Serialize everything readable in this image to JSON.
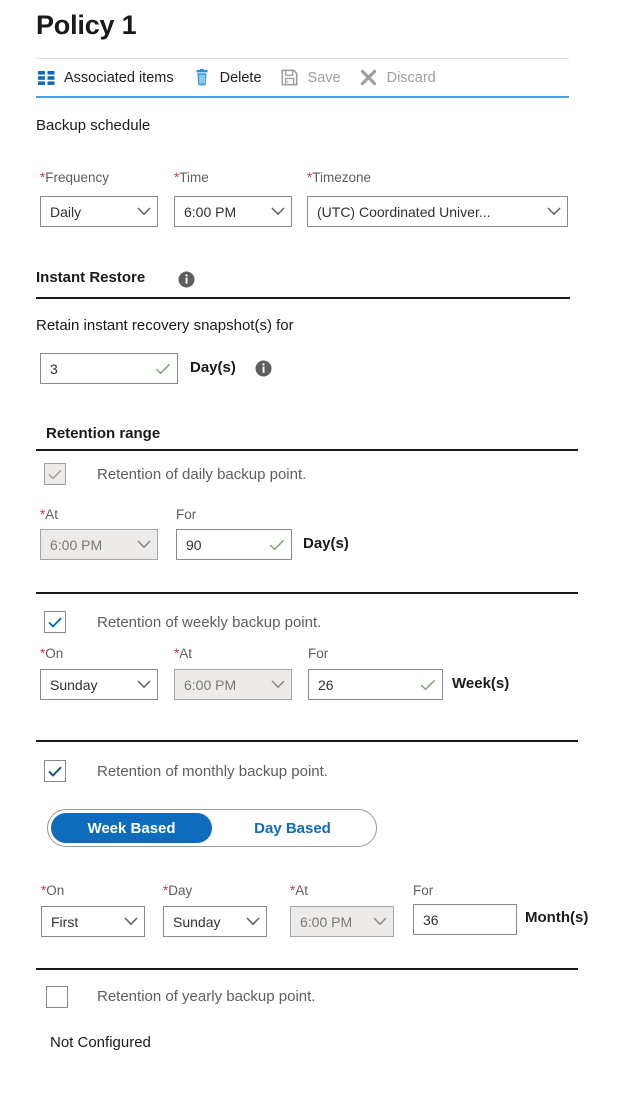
{
  "page": {
    "title": "Policy 1"
  },
  "toolbar": {
    "items": [
      {
        "label": "Associated items",
        "icon": "grid-icon",
        "enabled": true
      },
      {
        "label": "Delete",
        "icon": "trash-icon",
        "enabled": true
      },
      {
        "label": "Save",
        "icon": "save-icon",
        "enabled": false
      },
      {
        "label": "Discard",
        "icon": "discard-x-icon",
        "enabled": false
      }
    ]
  },
  "backup_schedule": {
    "heading": "Backup schedule",
    "frequency": {
      "label": "Frequency",
      "required": "*",
      "value": "Daily"
    },
    "time": {
      "label": "Time",
      "required": "*",
      "value": "6:00 PM"
    },
    "timezone": {
      "label": "Timezone",
      "required": "*",
      "value": "(UTC) Coordinated Univer..."
    }
  },
  "instant_restore": {
    "heading": "Instant Restore",
    "info_icon": "info-icon",
    "description": "Retain instant recovery snapshot(s) for",
    "days_value": "3",
    "days_unit": "Day(s)",
    "unit_info_icon": "info-icon"
  },
  "retention_range": {
    "heading": "Retention range",
    "daily": {
      "checked": true,
      "enabled": false,
      "label": "Retention of daily backup point.",
      "at": {
        "label": "At",
        "required": "*",
        "value": "6:00 PM",
        "enabled": false
      },
      "for": {
        "label": "For",
        "required": "",
        "value": "90",
        "enabled": true
      },
      "unit": "Day(s)"
    },
    "weekly": {
      "checked": true,
      "enabled": true,
      "label": "Retention of weekly backup point.",
      "on": {
        "label": "On",
        "required": "*",
        "value": "Sunday",
        "enabled": true
      },
      "at": {
        "label": "At",
        "required": "*",
        "value": "6:00 PM",
        "enabled": false
      },
      "for": {
        "label": "For",
        "required": "",
        "value": "26",
        "enabled": true
      },
      "unit": "Week(s)"
    },
    "monthly": {
      "checked": true,
      "enabled": true,
      "label": "Retention of monthly backup point.",
      "toggle": {
        "options": [
          "Week Based",
          "Day Based"
        ],
        "selected": "Week Based"
      },
      "on": {
        "label": "On",
        "required": "*",
        "value": "First",
        "enabled": true
      },
      "day": {
        "label": "Day",
        "required": "*",
        "value": "Sunday",
        "enabled": true
      },
      "at": {
        "label": "At",
        "required": "*",
        "value": "6:00 PM",
        "enabled": false
      },
      "for": {
        "label": "For",
        "required": "",
        "value": "36",
        "enabled": true
      },
      "unit": "Month(s)"
    },
    "yearly": {
      "checked": false,
      "enabled": true,
      "label": "Retention of yearly backup point.",
      "status": "Not Configured"
    }
  },
  "colors": {
    "accent": "#0f6cbd",
    "cmdbar_underline": "#4aa3df",
    "required_asterisk": "#d13438",
    "valid_tick": "#7aa86f",
    "disabled_bg": "#edebe9"
  }
}
